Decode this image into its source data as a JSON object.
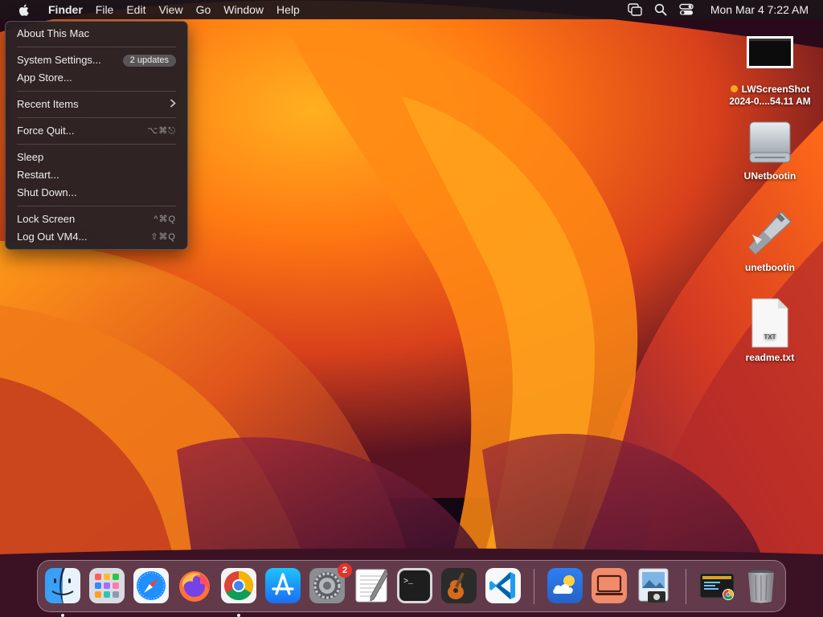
{
  "colors": {
    "menubar_bg": "#1c161a",
    "menu_bg": "#262024",
    "wallpaper_deep": "#3a0d12",
    "wallpaper_orange": "#ff7a12",
    "wallpaper_red": "#d8401c",
    "wallpaper_purple": "#7a1e3e",
    "notification_red": "#e5322b",
    "screenshot_tag_orange": "#f5a623"
  },
  "menubar": {
    "apple_icon": "apple-logo-icon",
    "app_name": "Finder",
    "items": [
      "File",
      "Edit",
      "View",
      "Go",
      "Window",
      "Help"
    ],
    "status_icons": [
      "screen-mirroring-icon",
      "spotlight-search-icon",
      "control-center-icon"
    ],
    "clock": "Mon Mar 4  7:22 AM"
  },
  "apple_menu": {
    "about": "About This Mac",
    "system_settings": "System Settings...",
    "updates_badge": "2 updates",
    "app_store": "App Store...",
    "recent_items": "Recent Items",
    "force_quit": "Force Quit...",
    "force_quit_shortcut": "⌥⌘⎋",
    "sleep": "Sleep",
    "restart": "Restart...",
    "shut_down": "Shut Down...",
    "lock_screen": "Lock Screen",
    "lock_screen_shortcut": "^⌘Q",
    "log_out": "Log Out VM4...",
    "log_out_shortcut": "⇧⌘Q"
  },
  "desktop_icons": [
    {
      "line1": "LWScreenShot",
      "line2": "2024-0....54.11 AM",
      "icon": "screenshot-thumbnail-icon",
      "tag_color": "#f5a623"
    },
    {
      "line1": "UNetbootin",
      "icon": "disk-volume-icon"
    },
    {
      "line1": "unetbootin",
      "icon": "unetbootin-app-icon"
    },
    {
      "line1": "readme.txt",
      "icon": "text-document-icon",
      "badge": "TXT"
    }
  ],
  "dock": {
    "apps": [
      {
        "name": "Finder",
        "icon": "finder-icon",
        "running": true
      },
      {
        "name": "Launchpad",
        "icon": "launchpad-icon",
        "running": false
      },
      {
        "name": "Safari",
        "icon": "safari-icon",
        "running": false
      },
      {
        "name": "Firefox",
        "icon": "firefox-icon",
        "running": false
      },
      {
        "name": "Google Chrome",
        "icon": "chrome-icon",
        "running": true
      },
      {
        "name": "App Store",
        "icon": "app-store-icon",
        "running": false
      },
      {
        "name": "System Settings",
        "icon": "system-settings-icon",
        "running": false,
        "badge": "2"
      },
      {
        "name": "TextEdit",
        "icon": "textedit-icon",
        "running": false
      },
      {
        "name": "Terminal",
        "icon": "terminal-icon",
        "running": false,
        "glyph": ">_"
      },
      {
        "name": "GarageBand",
        "icon": "garageband-icon",
        "running": false
      },
      {
        "name": "Visual Studio Code",
        "icon": "vscode-icon",
        "running": false
      }
    ],
    "recent_apps": [
      {
        "name": "Weather",
        "icon": "weather-icon"
      },
      {
        "name": "Screen Sharing",
        "icon": "screen-sharing-icon"
      },
      {
        "name": "Preview",
        "icon": "preview-icon"
      }
    ],
    "tail": [
      {
        "name": "Downloads",
        "icon": "downloads-stack-icon"
      },
      {
        "name": "Trash",
        "icon": "trash-icon"
      }
    ]
  }
}
